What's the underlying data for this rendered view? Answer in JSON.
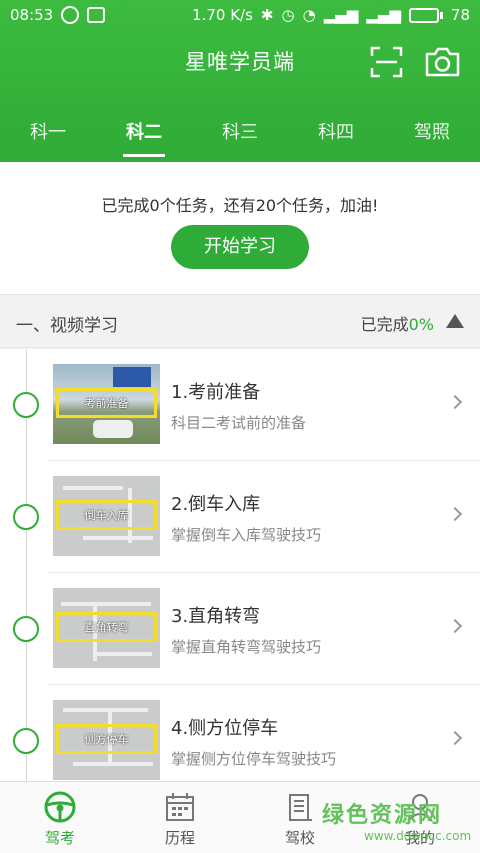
{
  "status_bar": {
    "time": "08:53",
    "speed": "1.70 K/s",
    "battery": "78"
  },
  "header": {
    "title": "星唯学员端"
  },
  "tabs": [
    {
      "label": "科一"
    },
    {
      "label": "科二"
    },
    {
      "label": "科三"
    },
    {
      "label": "科四"
    },
    {
      "label": "驾照"
    }
  ],
  "summary": {
    "text": "已完成0个任务，还有20个任务，加油!",
    "start_button": "开始学习"
  },
  "section": {
    "title": "一、视频学习",
    "status_label": "已完成",
    "percent": "0%"
  },
  "items": [
    {
      "title": "1.考前准备",
      "desc": "科目二考试前的准备",
      "thumb_caption": "考前准备"
    },
    {
      "title": "2.倒车入库",
      "desc": "掌握倒车入库驾驶技巧",
      "thumb_caption": "倒车入库"
    },
    {
      "title": "3.直角转弯",
      "desc": "掌握直角转弯驾驶技巧",
      "thumb_caption": "直角转弯"
    },
    {
      "title": "4.侧方位停车",
      "desc": "掌握侧方位停车驾驶技巧",
      "thumb_caption": "侧方停车"
    }
  ],
  "bottom_nav": [
    {
      "label": "驾考",
      "icon": "steering-wheel-icon"
    },
    {
      "label": "历程",
      "icon": "calendar-icon"
    },
    {
      "label": "驾校",
      "icon": "building-icon"
    },
    {
      "label": "我的",
      "icon": "user-icon"
    }
  ],
  "watermark": {
    "brand": "绿色资源网",
    "site": "www.downcc.com"
  },
  "colors": {
    "primary": "#2fab37",
    "header": "#3dbb3f"
  }
}
